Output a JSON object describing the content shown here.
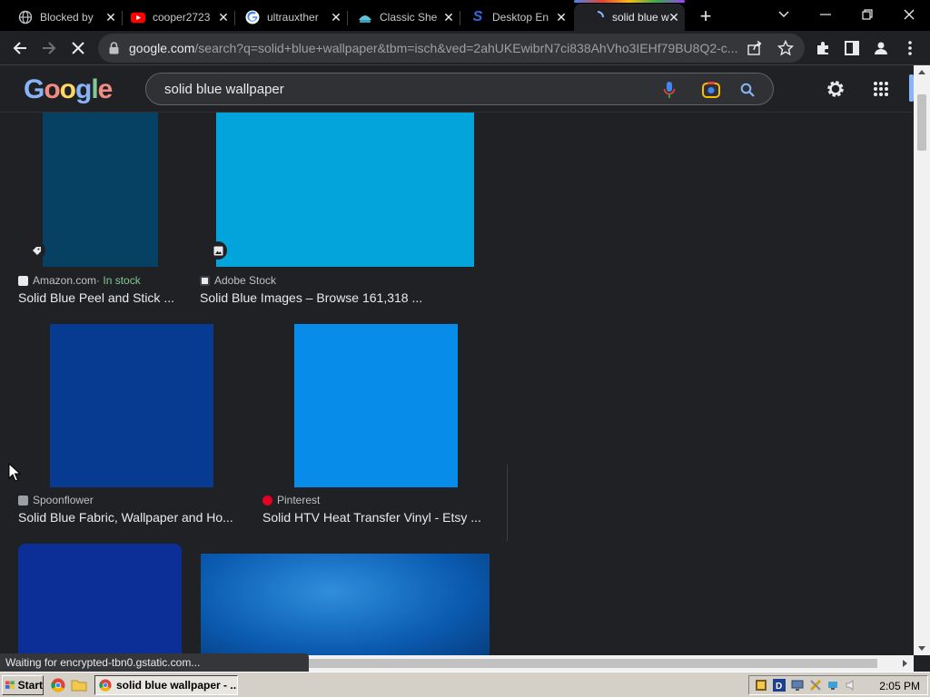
{
  "tabs": [
    {
      "title": "Blocked by",
      "icon": "globe-icon"
    },
    {
      "title": "cooper2723",
      "icon": "youtube-icon"
    },
    {
      "title": "ultrauxther",
      "icon": "google-icon"
    },
    {
      "title": "Classic She",
      "icon": "shell-icon"
    },
    {
      "title": "Desktop En",
      "icon": "s-logo-icon"
    },
    {
      "title": "solid blue w",
      "icon": "loading-icon",
      "active": true
    }
  ],
  "toolbar": {
    "url_host": "google.com",
    "url_rest": "/search?q=solid+blue+wallpaper&tbm=isch&ved=2ahUKEwibrN7ci838AhVho3IEHf79BU8Q2-c..."
  },
  "search": {
    "logo_text": "Google",
    "query": "solid blue wallpaper"
  },
  "results": [
    {
      "source": "Amazon.com",
      "stock": " · In stock",
      "caption": "Solid Blue Peel and Stick ...",
      "color": "#064163",
      "badge": "tag-icon"
    },
    {
      "source": "Adobe Stock",
      "caption": "Solid Blue Images – Browse 161,318 ...",
      "color": "#03a3db",
      "badge": "image-icon"
    },
    {
      "source": "Spoonflower",
      "caption": "Solid Blue Fabric, Wallpaper and Ho...",
      "color": "#073a91"
    },
    {
      "source": "Pinterest",
      "caption": "Solid HTV Heat Transfer Vinyl - Etsy ...",
      "color": "#078ce9"
    },
    {
      "color": "#0b2f96"
    },
    {
      "color": "#0a5ab0"
    }
  ],
  "status_text": "Waiting for encrypted-tbn0.gstatic.com...",
  "taskbar": {
    "start_label": "Start",
    "window_label": "solid blue wallpaper - ...",
    "clock": "2:05 PM"
  },
  "colors": {
    "accent_blue": "#8ab4f8",
    "page_bg": "#202124"
  }
}
